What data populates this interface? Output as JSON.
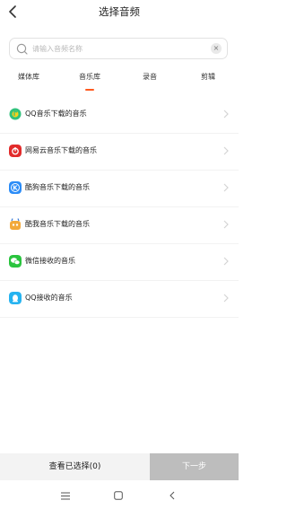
{
  "header": {
    "title": "选择音频"
  },
  "search": {
    "placeholder": "请输入音频名称",
    "value": ""
  },
  "tabs": [
    {
      "label": "媒体库",
      "active": false
    },
    {
      "label": "音乐库",
      "active": true
    },
    {
      "label": "录音",
      "active": false
    },
    {
      "label": "剪辑",
      "active": false
    }
  ],
  "list": [
    {
      "label": "QQ音乐下载的音乐",
      "icon": "qq-music-icon",
      "color": "#31c27c"
    },
    {
      "label": "网易云音乐下载的音乐",
      "icon": "netease-music-icon",
      "color": "#e22b2b"
    },
    {
      "label": "酷狗音乐下载的音乐",
      "icon": "kugou-music-icon",
      "color": "#2b8cf7"
    },
    {
      "label": "酷我音乐下载的音乐",
      "icon": "kuwo-music-icon",
      "color": "#f2a93b"
    },
    {
      "label": "微信接收的音乐",
      "icon": "wechat-icon",
      "color": "#2ac43e"
    },
    {
      "label": "QQ接收的音乐",
      "icon": "qq-icon",
      "color": "#26b3f0"
    }
  ],
  "bottom": {
    "view_selected_label": "查看已选择(0)",
    "next_label": "下一步"
  },
  "colors": {
    "accent": "#ff5a1f",
    "disabled_button": "#bdbdbd"
  }
}
